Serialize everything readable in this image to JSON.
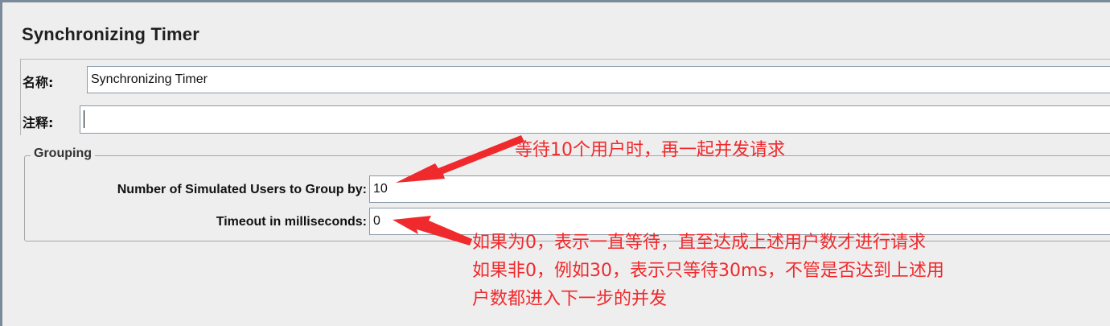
{
  "panel": {
    "title": "Synchronizing Timer"
  },
  "name_field": {
    "label": "名称:",
    "value": "Synchronizing Timer"
  },
  "comment_field": {
    "label": "注释:",
    "value": ""
  },
  "grouping": {
    "title": "Grouping",
    "users_label": "Number of Simulated Users to Group by:",
    "users_value": "10",
    "timeout_label": "Timeout in milliseconds:",
    "timeout_value": "0"
  },
  "annotations": {
    "users_note": "等待10个用户时，再一起并发请求",
    "timeout_note": [
      "如果为0，表示一直等待，直至达成上述用户数才进行请求",
      "如果非0，例如30，表示只等待30ms，不管是否达到上述用",
      "户数都进入下一步的并发"
    ]
  },
  "colors": {
    "annotation": "#f0292c",
    "background": "#eeeeee",
    "field_border": "#8b9aa9"
  }
}
